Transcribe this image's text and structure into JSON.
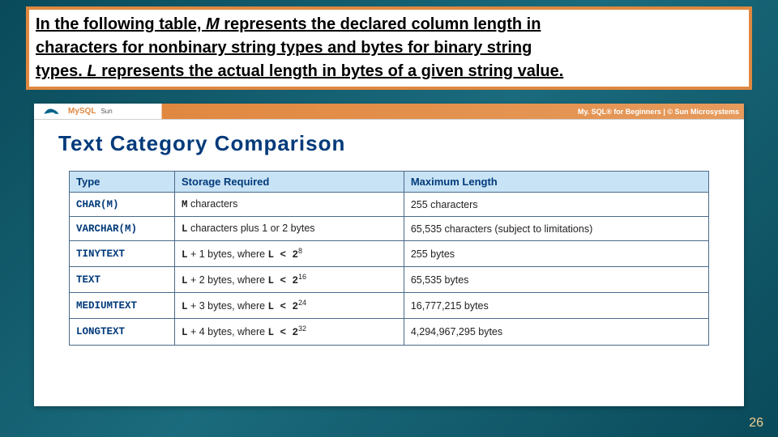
{
  "intro": {
    "p1a": "In the following table, ",
    "p1b": "M",
    "p1c": " represents the declared column length in",
    "p2": "characters for nonbinary string types and bytes for binary string",
    "p3a": "types.  ",
    "p3b": "L",
    "p3c": " represents the actual length in bytes of a given string value."
  },
  "strip": {
    "left_logo_text": "MySQL",
    "left_sun": "Sun",
    "right": "My. SQL® for Beginners | © Sun Microsystems"
  },
  "heading": "Text Category Comparison",
  "columns": {
    "c0": "Type",
    "c1": "Storage Required",
    "c2": "Maximum Length"
  },
  "rows": [
    {
      "type": "CHAR(M)",
      "storage_pre": "M",
      "storage_post": " characters",
      "exp": "",
      "max": "255 characters"
    },
    {
      "type": "VARCHAR(M)",
      "storage_pre": "L",
      "storage_post": " characters plus 1 or 2 bytes",
      "exp": "",
      "max": "65,535 characters (subject to limitations)"
    },
    {
      "type": "TINYTEXT",
      "storage_pre": "L",
      "storage_post": " + 1 bytes, where ",
      "cond": "L < 2",
      "exp": "8",
      "max": "255 bytes"
    },
    {
      "type": "TEXT",
      "storage_pre": "L",
      "storage_post": " + 2 bytes, where ",
      "cond": "L < 2",
      "exp": "16",
      "max": "65,535 bytes"
    },
    {
      "type": "MEDIUMTEXT",
      "storage_pre": "L",
      "storage_post": " + 3 bytes, where ",
      "cond": "L < 2",
      "exp": "24",
      "max": "16,777,215 bytes"
    },
    {
      "type": "LONGTEXT",
      "storage_pre": "L",
      "storage_post": " + 4 bytes, where ",
      "cond": "L < 2",
      "exp": "32",
      "max": "4,294,967,295 bytes"
    }
  ],
  "page_number": "26",
  "chart_data": {
    "type": "table",
    "title": "Text Category Comparison",
    "columns": [
      "Type",
      "Storage Required",
      "Maximum Length"
    ],
    "rows": [
      [
        "CHAR(M)",
        "M characters",
        "255 characters"
      ],
      [
        "VARCHAR(M)",
        "L characters plus 1 or 2 bytes",
        "65,535 characters (subject to limitations)"
      ],
      [
        "TINYTEXT",
        "L + 1 bytes, where L < 2^8",
        "255 bytes"
      ],
      [
        "TEXT",
        "L + 2 bytes, where L < 2^16",
        "65,535 bytes"
      ],
      [
        "MEDIUMTEXT",
        "L + 3 bytes, where L < 2^24",
        "16,777,215 bytes"
      ],
      [
        "LONGTEXT",
        "L + 4 bytes, where L < 2^32",
        "4,294,967,295 bytes"
      ]
    ]
  }
}
